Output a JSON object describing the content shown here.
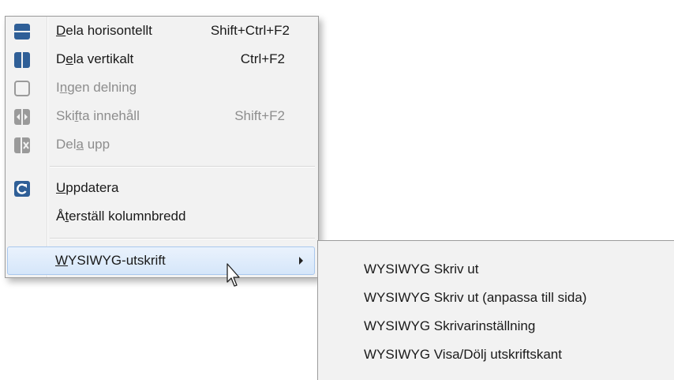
{
  "menu": {
    "items": [
      {
        "pre": "",
        "ul": "D",
        "post": "ela horisontellt",
        "shortcut": "Shift+Ctrl+F2",
        "icon": "split-horizontal-icon",
        "disabled": false
      },
      {
        "pre": "D",
        "ul": "e",
        "post": "la vertikalt",
        "shortcut": "Ctrl+F2",
        "icon": "split-vertical-icon",
        "disabled": false
      },
      {
        "pre": "I",
        "ul": "n",
        "post": "gen delning",
        "shortcut": "",
        "icon": "no-split-icon",
        "disabled": true
      },
      {
        "pre": "Ski",
        "ul": "f",
        "post": "ta innehåll",
        "shortcut": "Shift+F2",
        "icon": "swap-content-icon",
        "disabled": true
      },
      {
        "pre": "Del",
        "ul": "a",
        "post": " upp",
        "shortcut": "",
        "icon": "split-up-icon",
        "disabled": true
      },
      {
        "pre": "",
        "ul": "U",
        "post": "ppdatera",
        "shortcut": "",
        "icon": "refresh-icon",
        "disabled": false
      },
      {
        "pre": "Å",
        "ul": "t",
        "post": "erställ kolumnbredd",
        "shortcut": "",
        "icon": "",
        "disabled": false
      },
      {
        "pre": "",
        "ul": "W",
        "post": "YSIWYG-utskrift",
        "shortcut": "",
        "icon": "",
        "disabled": false,
        "has_submenu": true,
        "highlighted": true
      }
    ]
  },
  "submenu": {
    "items": [
      "WYSIWYG Skriv ut",
      "WYSIWYG Skriv ut (anpassa till sida)",
      "WYSIWYG Skrivarinställning",
      "WYSIWYG Visa/Dölj utskriftskant"
    ]
  },
  "colors": {
    "menu_bg": "#f2f2f2",
    "highlight": "#d5e6fa",
    "icon_blue": "#2f5f97",
    "disabled_text": "#8d8d8d"
  }
}
